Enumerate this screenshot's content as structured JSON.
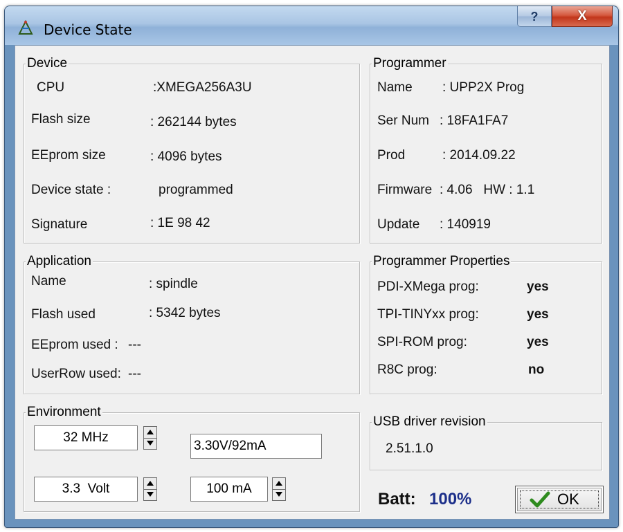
{
  "window": {
    "title": "Device State",
    "help_label": "?",
    "close_label": "X"
  },
  "device": {
    "title": "Device",
    "rows": [
      {
        "label": "CPU",
        "value": ":XMEGA256A3U"
      },
      {
        "label": "Flash size",
        "value": ": 262144 bytes"
      },
      {
        "label": "EEprom size",
        "value": ": 4096 bytes"
      },
      {
        "label": "Device state :",
        "value": "programmed"
      },
      {
        "label": "Signature",
        "value": ": 1E 98 42"
      }
    ]
  },
  "programmer": {
    "title": "Programmer",
    "rows": [
      {
        "label": "Name",
        "value": ": UPP2X Prog"
      },
      {
        "label": "Ser Num",
        "value": ": 18FA1FA7"
      },
      {
        "label": "Prod",
        "value": ": 2014.09.22"
      },
      {
        "label": "Firmware",
        "value": ": 4.06   HW : 1.1"
      },
      {
        "label": "Update",
        "value": ": 140919"
      }
    ]
  },
  "application": {
    "title": "Application",
    "rows": [
      {
        "label": "Name",
        "value": ": spindle"
      },
      {
        "label": "Flash used",
        "value": ": 5342 bytes"
      },
      {
        "label": "EEprom used :",
        "value": "---"
      },
      {
        "label": "UserRow used:",
        "value": "---"
      }
    ]
  },
  "properties": {
    "title": "Programmer Properties",
    "rows": [
      {
        "label": "PDI-XMega prog:",
        "value": "yes"
      },
      {
        "label": "TPI-TINYxx prog:",
        "value": "yes"
      },
      {
        "label": "SPI-ROM prog:",
        "value": "yes"
      },
      {
        "label": "R8C prog:",
        "value": "no"
      }
    ]
  },
  "environment": {
    "title": "Environment",
    "clock": "32 MHz",
    "voltage": "3.3  Volt",
    "current_limit": "100 mA",
    "readout": "3.30V/92mA"
  },
  "usb": {
    "title": "USB driver revision",
    "value": "2.51.1.0"
  },
  "battery": {
    "label": "Batt:",
    "value": "100%",
    "value_color": "#1c2f8a"
  },
  "ok_button": {
    "label": "OK",
    "check_color": "#2e8b1e"
  },
  "icons": {
    "app": "antenna-icon",
    "help": "help-icon",
    "close": "close-icon",
    "check": "checkmark-icon",
    "spin": "spin-arrows-icon"
  }
}
